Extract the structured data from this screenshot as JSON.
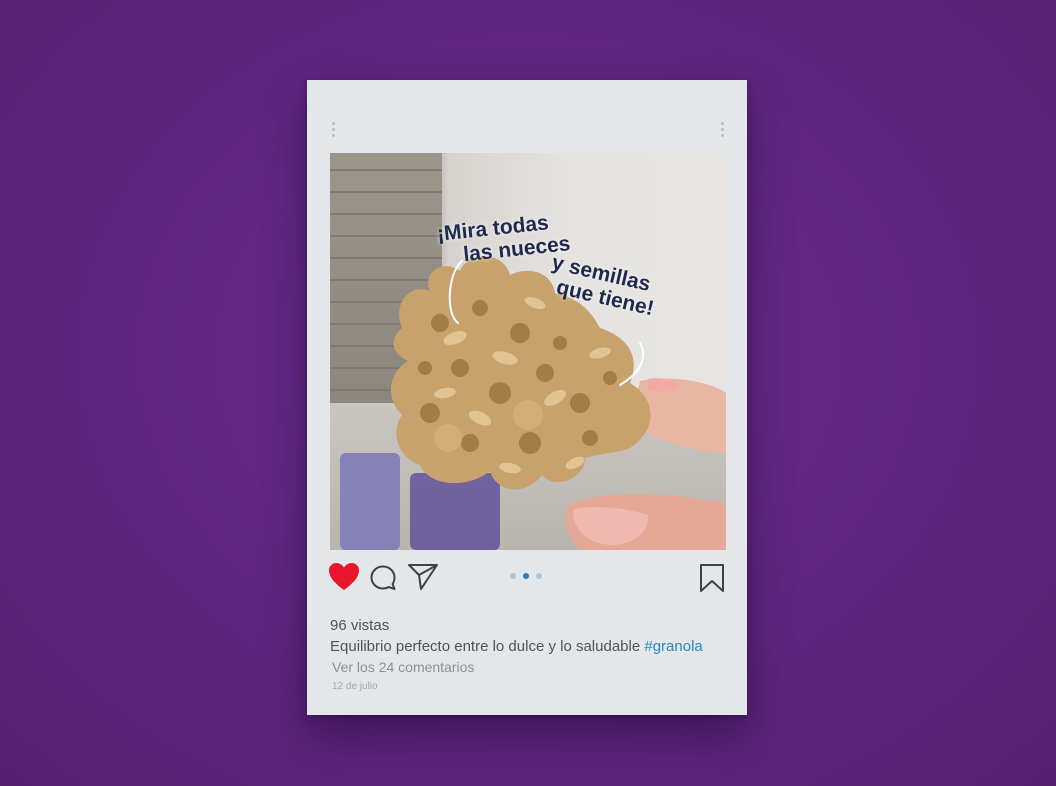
{
  "post": {
    "image_caption_1_line1": "¡Mira todas",
    "image_caption_1_line2": "las nueces",
    "image_caption_2_line1": "y semillas",
    "image_caption_2_line2": "que tiene!",
    "views": "96 vistas",
    "description": "Equilibrio perfecto entre lo dulce y lo saludable",
    "hashtag": "#granola",
    "comments_link": "Ver los 24 comentarios",
    "date": "12 de julio",
    "carousel": {
      "count": 3,
      "active_index": 1
    },
    "liked": true
  },
  "icons": {
    "like": "heart-icon",
    "comment": "comment-icon",
    "share": "send-icon",
    "save": "bookmark-icon"
  },
  "colors": {
    "background": "#5f2680",
    "card": "#e3e7ea",
    "heart": "#e8152b",
    "hashtag": "#2e86c1",
    "carousel_active": "#2d7fc1"
  }
}
